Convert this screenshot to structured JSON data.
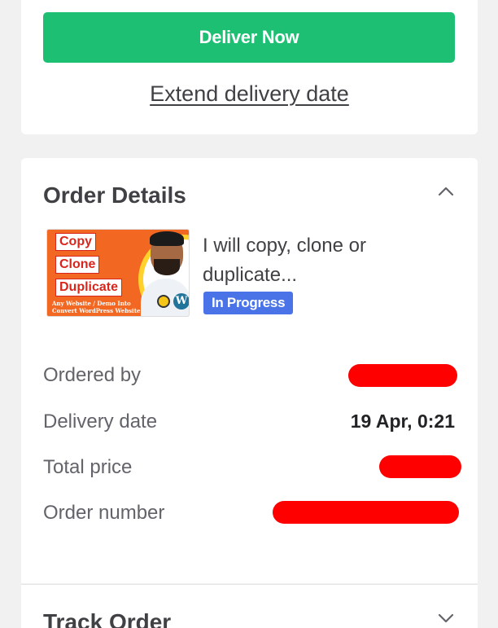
{
  "actions": {
    "deliver_label": "Deliver Now",
    "extend_label": "Extend delivery date"
  },
  "order_details": {
    "title": "Order Details",
    "thumbnail": {
      "tags": [
        "Copy",
        "Clone",
        "Duplicate"
      ],
      "subtitle": "Any Website / Demo Into Convert WordPress Website"
    },
    "gig_title": "I will copy, clone or duplicate...",
    "status": "In Progress",
    "rows": [
      {
        "label": "Ordered by",
        "value": null
      },
      {
        "label": "Delivery date",
        "value": "19 Apr, 0:21"
      },
      {
        "label": "Total price",
        "value": null
      },
      {
        "label": "Order number",
        "value": null
      }
    ]
  },
  "track_order": {
    "title": "Track Order"
  },
  "colors": {
    "primary_green": "#1dbf73",
    "status_blue": "#4a73e8",
    "redaction": "#ff0000"
  }
}
